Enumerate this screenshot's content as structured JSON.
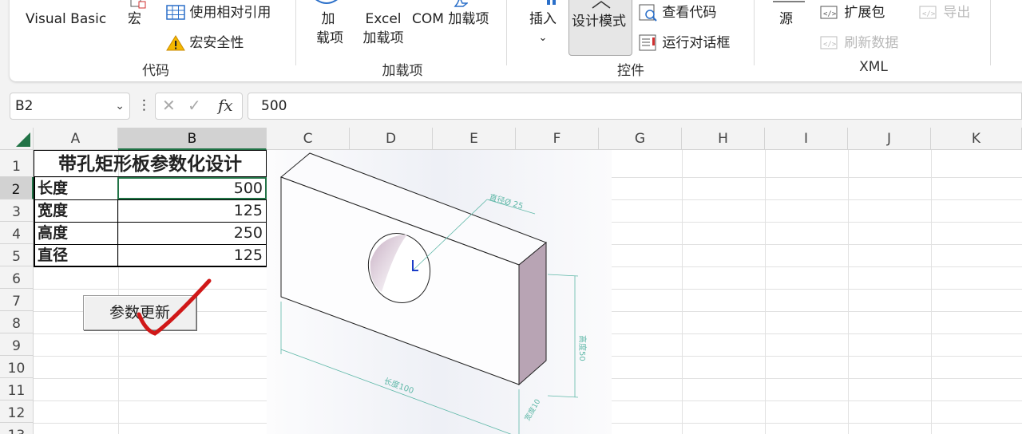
{
  "ribbon": {
    "code_group": {
      "visual_basic": "Visual Basic",
      "macros": "宏",
      "use_relative_ref": "使用相对引用",
      "macro_security": "宏安全性",
      "label": "代码"
    },
    "addins_group": {
      "addins_line1": "加",
      "addins_line2": "载项",
      "excel_addins_line1": "Excel",
      "excel_addins_line2": "加载项",
      "com_addins": "COM 加载项",
      "label": "加载项"
    },
    "controls_group": {
      "insert": "插入",
      "design_mode": "设计模式",
      "view_code": "查看代码",
      "run_dialog": "运行对话框",
      "label": "控件"
    },
    "xml_group": {
      "source": "源",
      "expansion_packs": "扩展包",
      "refresh_data": "刷新数据",
      "export": "导出",
      "label": "XML"
    }
  },
  "formula_bar": {
    "name_box": "B2",
    "fx_label": "fx",
    "value": "500"
  },
  "sheet": {
    "columns": [
      "A",
      "B",
      "C",
      "D",
      "E",
      "F",
      "G",
      "H",
      "I",
      "J",
      "K"
    ],
    "rows": [
      "1",
      "2",
      "3",
      "4",
      "5",
      "6",
      "7",
      "8",
      "9",
      "10",
      "11",
      "12",
      "13"
    ],
    "selected_column": "B",
    "selected_row": "2",
    "title": "带孔矩形板参数化设计",
    "params": [
      {
        "label": "长度",
        "value": "500"
      },
      {
        "label": "宽度",
        "value": "125"
      },
      {
        "label": "高度",
        "value": "250"
      },
      {
        "label": "直径",
        "value": "125"
      }
    ],
    "update_button": "参数更新"
  },
  "drawing": {
    "diameter_dim": "直径Ø 25",
    "length_dim": "长度100",
    "height_dim": "高度50",
    "width_dim": "宽度10"
  },
  "colors": {
    "excel_green": "#217346",
    "annotation_red": "#d01818",
    "dim_line": "#5fb8a8",
    "plate_side": "#b8a4b4"
  }
}
